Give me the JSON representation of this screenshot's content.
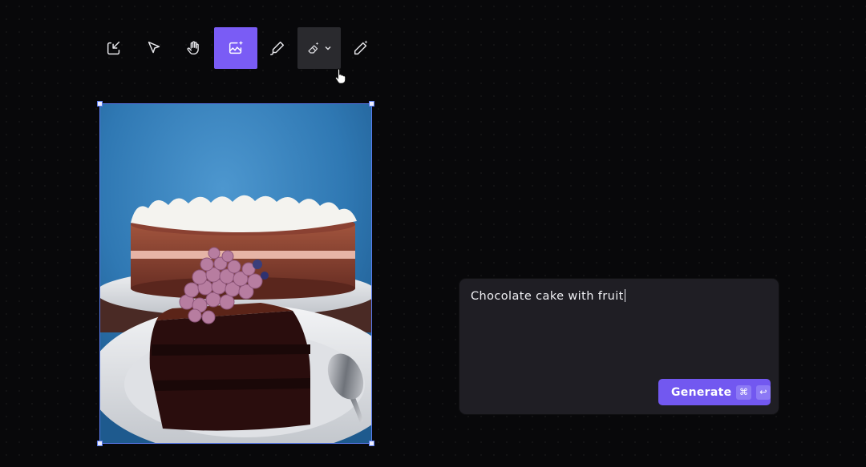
{
  "toolbar": {
    "tools": [
      {
        "name": "import",
        "icon": "import-icon"
      },
      {
        "name": "select",
        "icon": "cursor-arrow-icon"
      },
      {
        "name": "pan",
        "icon": "hand-icon"
      },
      {
        "name": "image-generate",
        "icon": "image-sparkle-icon",
        "active": true
      },
      {
        "name": "draw",
        "icon": "pencil-icon"
      },
      {
        "name": "erase",
        "icon": "eraser-sparkle-icon",
        "has_dropdown": true
      },
      {
        "name": "magic-wand",
        "icon": "magic-wand-icon"
      }
    ],
    "accent": "#7a5cf5"
  },
  "canvas": {
    "image_subject": "chocolate cake with fruit",
    "selection_color": "#5a7cf0"
  },
  "prompt": {
    "text": "Chocolate cake with fruit",
    "generate_label": "Generate",
    "shortcut_cmd": "⌘",
    "shortcut_enter": "↩"
  }
}
